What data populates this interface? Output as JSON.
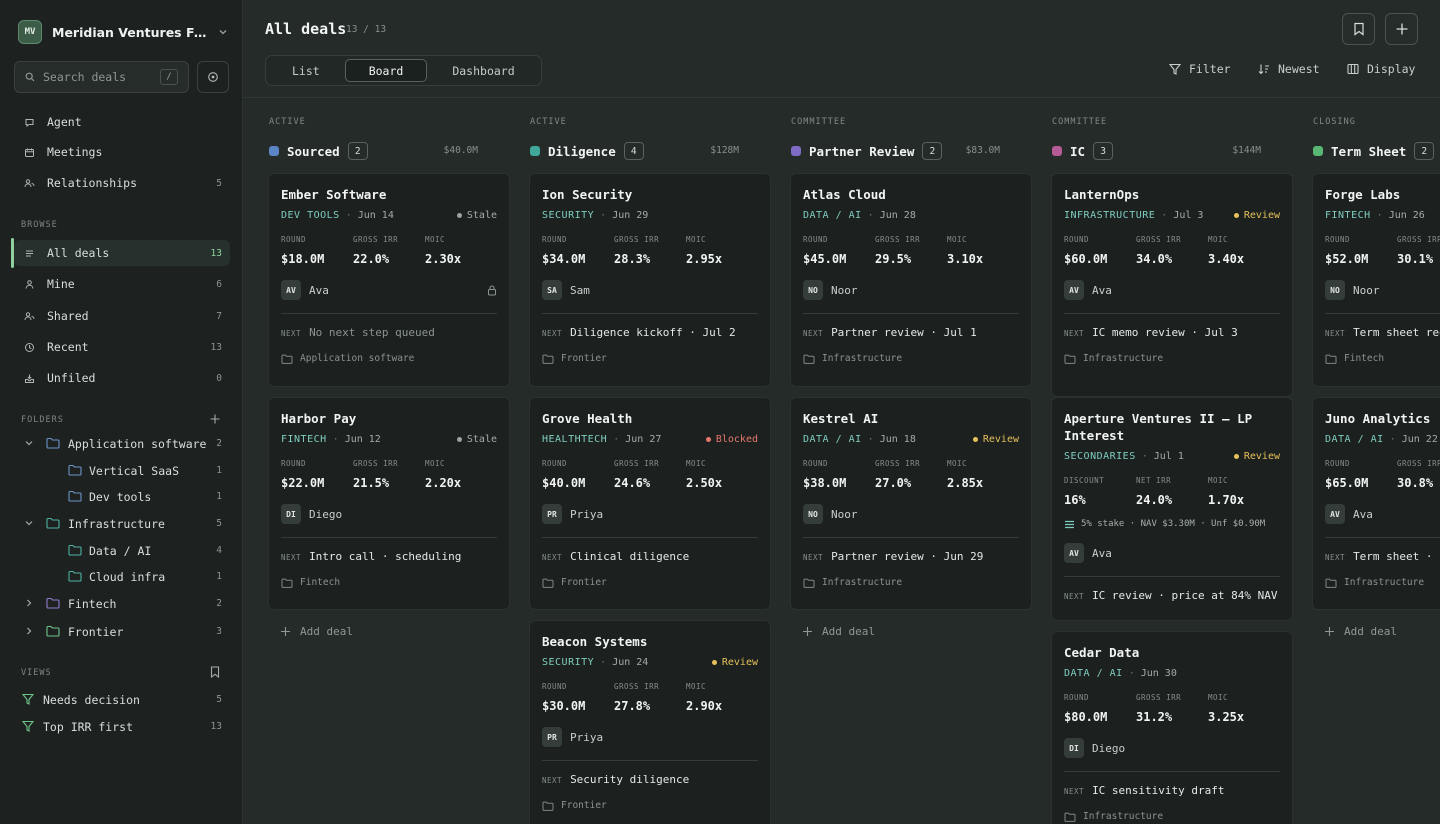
{
  "sidebar": {
    "workspace": {
      "initials": "MV",
      "name": "Meridian Ventures Fund II"
    },
    "search": {
      "placeholder": "Search deals",
      "shortcut": "/"
    },
    "primary": [
      {
        "label": "Agent",
        "icon": "chat-icon"
      },
      {
        "label": "Meetings",
        "icon": "calendar-icon"
      },
      {
        "label": "Relationships",
        "icon": "people-icon",
        "count": "5"
      }
    ],
    "browse_label": "BROWSE",
    "browse": [
      {
        "label": "All deals",
        "count": "13",
        "icon": "list-icon"
      },
      {
        "label": "Mine",
        "count": "6",
        "icon": "person-icon"
      },
      {
        "label": "Shared",
        "count": "7",
        "icon": "people-icon"
      },
      {
        "label": "Recent",
        "count": "13",
        "icon": "clock-icon"
      },
      {
        "label": "Unfiled",
        "count": "0",
        "icon": "inbox-icon"
      }
    ],
    "folders_label": "FOLDERS",
    "folders": [
      {
        "label": "Application software",
        "count": "2"
      },
      {
        "label": "Vertical SaaS",
        "count": "1"
      },
      {
        "label": "Dev tools",
        "count": "1"
      },
      {
        "label": "Infrastructure",
        "count": "5"
      },
      {
        "label": "Data / AI",
        "count": "4"
      },
      {
        "label": "Cloud infra",
        "count": "1"
      },
      {
        "label": "Fintech",
        "count": "2"
      },
      {
        "label": "Frontier",
        "count": "3"
      }
    ],
    "views_label": "VIEWS",
    "views": [
      {
        "label": "Needs decision",
        "count": "5"
      },
      {
        "label": "Top IRR first",
        "count": "13"
      }
    ]
  },
  "header": {
    "title": "All deals",
    "count": "13 / 13",
    "tabs": [
      "List",
      "Board",
      "Dashboard"
    ],
    "active_tab": "Board",
    "tools": {
      "filter": "Filter",
      "sort": "Newest",
      "display": "Display"
    }
  },
  "colors": {
    "accent": "#8fd19e",
    "sector": "#7fcdbf",
    "review": "#e7c15a",
    "blocked": "#e8776b",
    "stale": "#9aa39f"
  },
  "board": {
    "add_deal_label": "Add deal",
    "next_label": "NEXT",
    "columns": [
      {
        "stage": "ACTIVE",
        "name": "Sourced",
        "count": "2",
        "total": "$40.0M",
        "color": "#5b84c4",
        "cards": [
          {
            "title": "Ember Software",
            "sector": "DEV TOOLS",
            "date": "Jun 14",
            "status": "Stale",
            "metrics": [
              {
                "label": "ROUND",
                "value": "$18.0M"
              },
              {
                "label": "GROSS IRR",
                "value": "22.0%"
              },
              {
                "label": "MOIC",
                "value": "2.30x"
              }
            ],
            "owner": {
              "initials": "AV",
              "name": "Ava"
            },
            "next": "No next step queued",
            "folder": "Application software"
          },
          {
            "title": "Harbor Pay",
            "sector": "FINTECH",
            "date": "Jun 12",
            "status": "Stale",
            "metrics": [
              {
                "label": "ROUND",
                "value": "$22.0M"
              },
              {
                "label": "GROSS IRR",
                "value": "21.5%"
              },
              {
                "label": "MOIC",
                "value": "2.20x"
              }
            ],
            "owner": {
              "initials": "DI",
              "name": "Diego"
            },
            "next": "Intro call · scheduling",
            "folder": "Fintech"
          }
        ]
      },
      {
        "stage": "ACTIVE",
        "name": "Diligence",
        "count": "4",
        "total": "$128M",
        "color": "#3fa89a",
        "cards": [
          {
            "title": "Ion Security",
            "sector": "SECURITY",
            "date": "Jun 29",
            "status": "",
            "metrics": [
              {
                "label": "ROUND",
                "value": "$34.0M"
              },
              {
                "label": "GROSS IRR",
                "value": "28.3%"
              },
              {
                "label": "MOIC",
                "value": "2.95x"
              }
            ],
            "owner": {
              "initials": "SA",
              "name": "Sam"
            },
            "next": "Diligence kickoff · Jul 2",
            "folder": "Frontier"
          },
          {
            "title": "Grove Health",
            "sector": "HEALTHTECH",
            "date": "Jun 27",
            "status": "Blocked",
            "metrics": [
              {
                "label": "ROUND",
                "value": "$40.0M"
              },
              {
                "label": "GROSS IRR",
                "value": "24.6%"
              },
              {
                "label": "MOIC",
                "value": "2.50x"
              }
            ],
            "owner": {
              "initials": "PR",
              "name": "Priya"
            },
            "next": "Clinical diligence",
            "folder": "Frontier"
          },
          {
            "title": "Beacon Systems",
            "sector": "SECURITY",
            "date": "Jun 24",
            "status": "Review",
            "metrics": [
              {
                "label": "ROUND",
                "value": "$30.0M"
              },
              {
                "label": "GROSS IRR",
                "value": "27.8%"
              },
              {
                "label": "MOIC",
                "value": "2.90x"
              }
            ],
            "owner": {
              "initials": "PR",
              "name": "Priya"
            },
            "next": "Security diligence",
            "folder": "Frontier"
          }
        ]
      },
      {
        "stage": "COMMITTEE",
        "name": "Partner Review",
        "count": "2",
        "total": "$83.0M",
        "color": "#7d6bc4",
        "cards": [
          {
            "title": "Atlas Cloud",
            "sector": "DATA / AI",
            "date": "Jun 28",
            "status": "",
            "metrics": [
              {
                "label": "ROUND",
                "value": "$45.0M"
              },
              {
                "label": "GROSS IRR",
                "value": "29.5%"
              },
              {
                "label": "MOIC",
                "value": "3.10x"
              }
            ],
            "owner": {
              "initials": "NO",
              "name": "Noor"
            },
            "next": "Partner review · Jul 1",
            "folder": "Infrastructure"
          },
          {
            "title": "Kestrel AI",
            "sector": "DATA / AI",
            "date": "Jun 18",
            "status": "Review",
            "metrics": [
              {
                "label": "ROUND",
                "value": "$38.0M"
              },
              {
                "label": "GROSS IRR",
                "value": "27.0%"
              },
              {
                "label": "MOIC",
                "value": "2.85x"
              }
            ],
            "owner": {
              "initials": "NO",
              "name": "Noor"
            },
            "next": "Partner review · Jun 29",
            "folder": "Infrastructure"
          }
        ]
      },
      {
        "stage": "COMMITTEE",
        "name": "IC",
        "count": "3",
        "total": "$144M",
        "color": "#b65b95",
        "cards": [
          {
            "title": "LanternOps",
            "sector": "INFRASTRUCTURE",
            "date": "Jul 3",
            "status": "Review",
            "metrics": [
              {
                "label": "ROUND",
                "value": "$60.0M"
              },
              {
                "label": "GROSS IRR",
                "value": "34.0%"
              },
              {
                "label": "MOIC",
                "value": "3.40x"
              }
            ],
            "owner": {
              "initials": "AV",
              "name": "Ava"
            },
            "next": "IC memo review · Jul 3",
            "folder": "Infrastructure"
          },
          {
            "title": "Aperture Ventures II — LP Interest",
            "sector": "SECONDARIES",
            "date": "Jul 1",
            "status": "Review",
            "metrics": [
              {
                "label": "DISCOUNT",
                "value": "16%"
              },
              {
                "label": "NET IRR",
                "value": "24.0%"
              },
              {
                "label": "MOIC",
                "value": "1.70x"
              }
            ],
            "stake": "5% stake · NAV $3.30M · Unf $0.90M",
            "owner": {
              "initials": "AV",
              "name": "Ava"
            },
            "next": "IC review · price at 84% NAV",
            "folder": ""
          },
          {
            "title": "Cedar Data",
            "sector": "DATA / AI",
            "date": "Jun 30",
            "status": "",
            "metrics": [
              {
                "label": "ROUND",
                "value": "$80.0M"
              },
              {
                "label": "GROSS IRR",
                "value": "31.2%"
              },
              {
                "label": "MOIC",
                "value": "3.25x"
              }
            ],
            "owner": {
              "initials": "DI",
              "name": "Diego"
            },
            "next": "IC sensitivity draft",
            "folder": "Infrastructure"
          }
        ]
      },
      {
        "stage": "CLOSING",
        "name": "Term Sheet",
        "count": "2",
        "total": "",
        "color": "#58b873",
        "cards": [
          {
            "title": "Forge Labs",
            "sector": "FINTECH",
            "date": "Jun 26",
            "status": "",
            "metrics": [
              {
                "label": "ROUND",
                "value": "$52.0M"
              },
              {
                "label": "GROSS IRR",
                "value": "30.1%"
              },
              {
                "label": "MOIC",
                "value": ""
              }
            ],
            "owner": {
              "initials": "NO",
              "name": "Noor"
            },
            "next": "Term sheet redl",
            "folder": "Fintech"
          },
          {
            "title": "Juno Analytics",
            "sector": "DATA / AI",
            "date": "Jun 22",
            "status": "",
            "metrics": [
              {
                "label": "ROUND",
                "value": "$65.0M"
              },
              {
                "label": "GROSS IRR",
                "value": "30.8%"
              },
              {
                "label": "MOIC",
                "value": ""
              }
            ],
            "owner": {
              "initials": "AV",
              "name": "Ava"
            },
            "next": "Term sheet · le",
            "folder": "Infrastructure"
          }
        ]
      }
    ]
  }
}
